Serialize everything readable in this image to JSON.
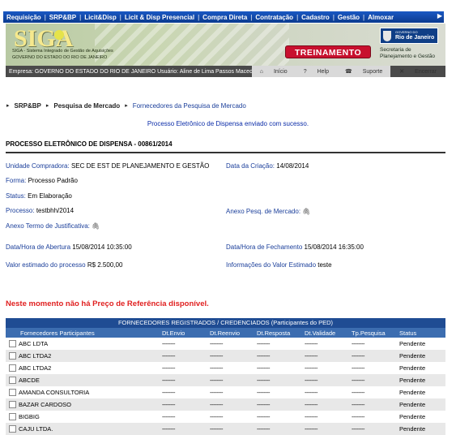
{
  "nav": {
    "items": [
      "Requisição",
      "SRP&BP",
      "Licit&Disp",
      "Licit & Disp Presencial",
      "Compra Direta",
      "Contratação",
      "Cadastro",
      "Gestão",
      "Almoxar"
    ]
  },
  "banner": {
    "logo": "SIGA",
    "subtitle_line1": "SIGA - Sistema Integrado de Gestão de Aquisições",
    "subtitle_line2": "GOVERNO DO ESTADO DO RIO DE JANEIRO",
    "environment_badge": "TREINAMENTO",
    "gov_small": "GOVERNO DO",
    "gov_big": "Rio de Janeiro",
    "secretaria_line1": "Secretaria de",
    "secretaria_line2": "Planejamento e Gestão"
  },
  "userbar": {
    "text": "Empresa: GOVERNO DO ESTADO DO RIO DE JANEIRO   Usuário: Aline de Lima Passos Macedo",
    "inicio": "Início",
    "help": "Help",
    "suporte": "Suporte",
    "encerrar": "Encerrar"
  },
  "breadcrumb": [
    "SRP&BP",
    "Pesquisa de Mercado",
    "Fornecedores da Pesquisa de Mercado"
  ],
  "success_message": "Processo Eletrônico de Dispensa enviado com sucesso.",
  "process_title": "PROCESSO ELETRÔNICO DE DISPENSA - 00861/2014",
  "fields": {
    "unidade_label": "Unidade Compradora:",
    "unidade_value": "SEC DE EST DE PLANEJAMENTO E GESTÃO",
    "data_criacao_label": "Data da Criação:",
    "data_criacao_value": "14/08/2014",
    "forma_label": "Forma:",
    "forma_value": "Processo Padrão",
    "status_label": "Status:",
    "status_value": "Em Elaboração",
    "processo_label": "Processo:",
    "processo_value": "testbhh/2014",
    "anexo_pesq_label": "Anexo Pesq. de Mercado:",
    "anexo_termo_label": "Anexo Termo de Justificativa:",
    "abertura_label": "Data/Hora de Abertura",
    "abertura_value": "15/08/2014 10:35:00",
    "fechamento_label": "Data/Hora de Fechamento",
    "fechamento_value": "15/08/2014 16:35:00",
    "valor_label": "Valor estimado do processo",
    "valor_value": "R$ 2.500,00",
    "info_label": "Informações do Valor Estimado",
    "info_value": "teste"
  },
  "no_price_message": "Neste momento não há Preço de Referência disponível.",
  "table": {
    "caption": "FORNECEDORES  REGISTRADOS / CREDENCIADOS (Participantes do PED)",
    "headers": [
      "Fornecedores Participantes",
      "Dt.Envio",
      "Dt.Reenvio",
      "Dt.Resposta",
      "Dt.Validade",
      "Tp.Pesquisa",
      "Status"
    ],
    "dash": "--------",
    "rows": [
      {
        "name": "ABC LDTA",
        "status": "Pendente"
      },
      {
        "name": "ABC LTDA2",
        "status": "Pendente"
      },
      {
        "name": "ABC LTDA2",
        "status": "Pendente"
      },
      {
        "name": "ABCDE",
        "status": "Pendente"
      },
      {
        "name": "AMANDA CONSULTORIA",
        "status": "Pendente"
      },
      {
        "name": "BAZAR CARDOSO",
        "status": "Pendente"
      },
      {
        "name": "BIGBIG",
        "status": "Pendente"
      },
      {
        "name": "CAJU LTDA.",
        "status": "Pendente"
      }
    ]
  }
}
